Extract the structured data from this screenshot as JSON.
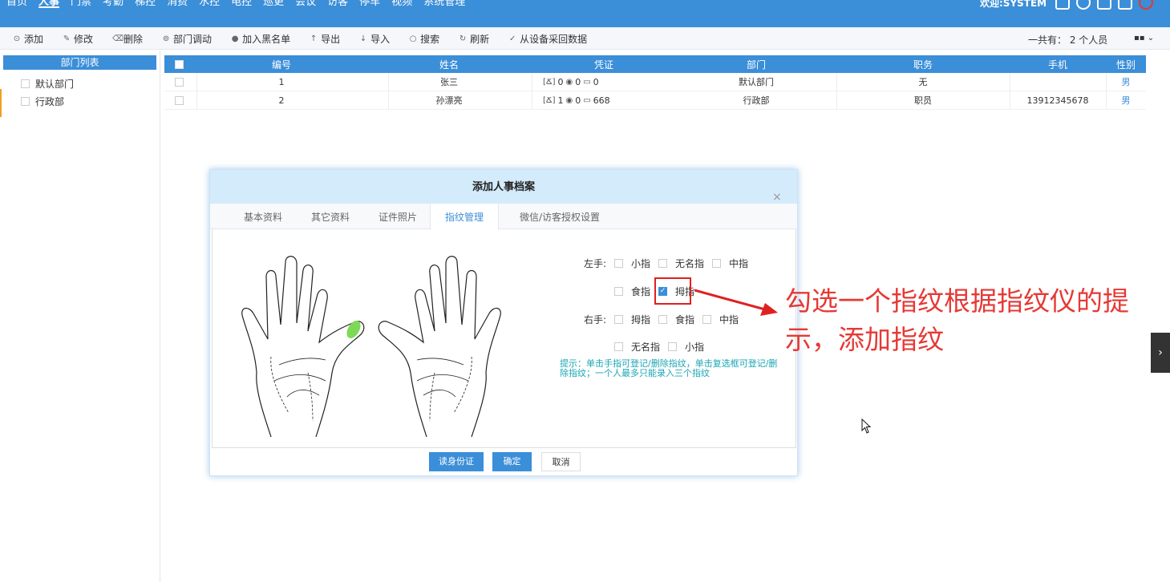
{
  "topbar": {
    "nav": [
      "首页",
      "人事",
      "门禁",
      "考勤",
      "梯控",
      "消费",
      "水控",
      "电控",
      "巡更",
      "会议",
      "访客",
      "停车",
      "视频",
      "系统管理"
    ],
    "active": "人事",
    "welcome": "欢迎:SYSTEM"
  },
  "toolbar": {
    "tools": [
      {
        "icon": "⊙",
        "label": "添加"
      },
      {
        "icon": "✎",
        "label": "修改"
      },
      {
        "icon": "⌫",
        "label": "删除"
      },
      {
        "icon": "⊚",
        "label": "部门调动"
      },
      {
        "icon": "●",
        "label": "加入黑名单"
      },
      {
        "icon": "↑",
        "label": "导出"
      },
      {
        "icon": "↓",
        "label": "导入"
      },
      {
        "icon": "○",
        "label": "搜索"
      },
      {
        "icon": "↻",
        "label": "刷新"
      },
      {
        "icon": "✓",
        "label": "从设备采回数据"
      }
    ],
    "count": "一共有： 2 个人员"
  },
  "dept_panel": {
    "title": "部门列表",
    "items": [
      "默认部门",
      "行政部"
    ]
  },
  "table": {
    "headers": [
      "编号",
      "姓名",
      "凭证",
      "部门",
      "职务",
      "手机",
      "性别"
    ],
    "rows": [
      {
        "id": "1",
        "name": "张三",
        "face": "0",
        "finger": "0",
        "card": "0",
        "dept": "默认部门",
        "title": "无",
        "phone": "",
        "gender": "男"
      },
      {
        "id": "2",
        "name": "孙漂亮",
        "face": "1",
        "finger": "0",
        "card": "668",
        "dept": "行政部",
        "title": "职员",
        "phone": "13912345678",
        "gender": "男"
      }
    ]
  },
  "modal": {
    "title": "添加人事档案",
    "close": "×",
    "tabs": [
      "基本资料",
      "其它资料",
      "证件照片",
      "指纹管理",
      "微信/访客授权设置"
    ],
    "active_tab": "指纹管理",
    "left_label": "左手:",
    "left_row1": [
      "小指",
      "无名指",
      "中指"
    ],
    "left_row2": [
      "食指",
      "拇指"
    ],
    "right_label": "右手:",
    "right_row1": [
      "拇指",
      "食指",
      "中指"
    ],
    "right_row2": [
      "无名指",
      "小指"
    ],
    "checked": "左手拇指",
    "hint": "提示：单击手指可登记/删除指纹，单击复选框可登记/删除指纹；一个人最多只能录入三个指纹",
    "buttons": {
      "read_id": "读身份证",
      "ok": "确定",
      "cancel": "取消"
    }
  },
  "annotation": {
    "text": "勾选一个指纹根据指纹仪的提示，添加指纹"
  },
  "colors": {
    "primary": "#3b8ed8",
    "annotation": "#e53935",
    "hint": "#1aa5b3",
    "selected_finger": "#7ed957"
  }
}
